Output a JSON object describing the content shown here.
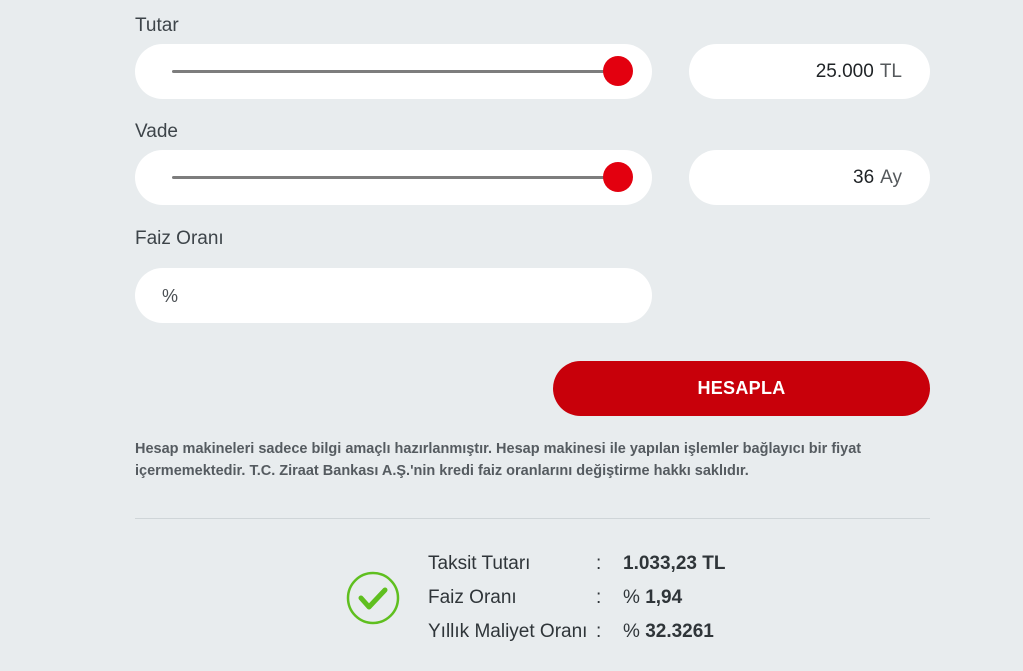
{
  "tutar": {
    "label": "Tutar",
    "slider_fraction": 1.0,
    "value": "25.000",
    "unit": "TL"
  },
  "vade": {
    "label": "Vade",
    "slider_fraction": 1.0,
    "value": "36",
    "unit": "Ay"
  },
  "faiz": {
    "label": "Faiz Oranı",
    "placeholder": "%"
  },
  "button": {
    "label": "HESAPLA"
  },
  "disclaimer": "Hesap makineleri sadece bilgi amaçlı hazırlanmıştır. Hesap makinesi ile yapılan işlemler bağlayıcı bir fiyat içermemektedir. T.C. Ziraat Bankası A.Ş.'nin kredi faiz oranlarını değiştirme hakkı saklıdır.",
  "results": [
    {
      "key": "Taksit Tutarı",
      "colon": ":",
      "value": "1.033,23 TL"
    },
    {
      "key": "Faiz Oranı",
      "colon": ":",
      "prefix": "%",
      "value": "1,94"
    },
    {
      "key": "Yıllık Maliyet Oranı",
      "colon": ":",
      "prefix": "%",
      "value": "32.3261"
    }
  ],
  "colors": {
    "accent": "#e3000f",
    "button": "#c8000a",
    "check": "#5fbf1f",
    "background": "#e8ecee"
  },
  "icons": {
    "result_status": "check-circle-icon"
  }
}
